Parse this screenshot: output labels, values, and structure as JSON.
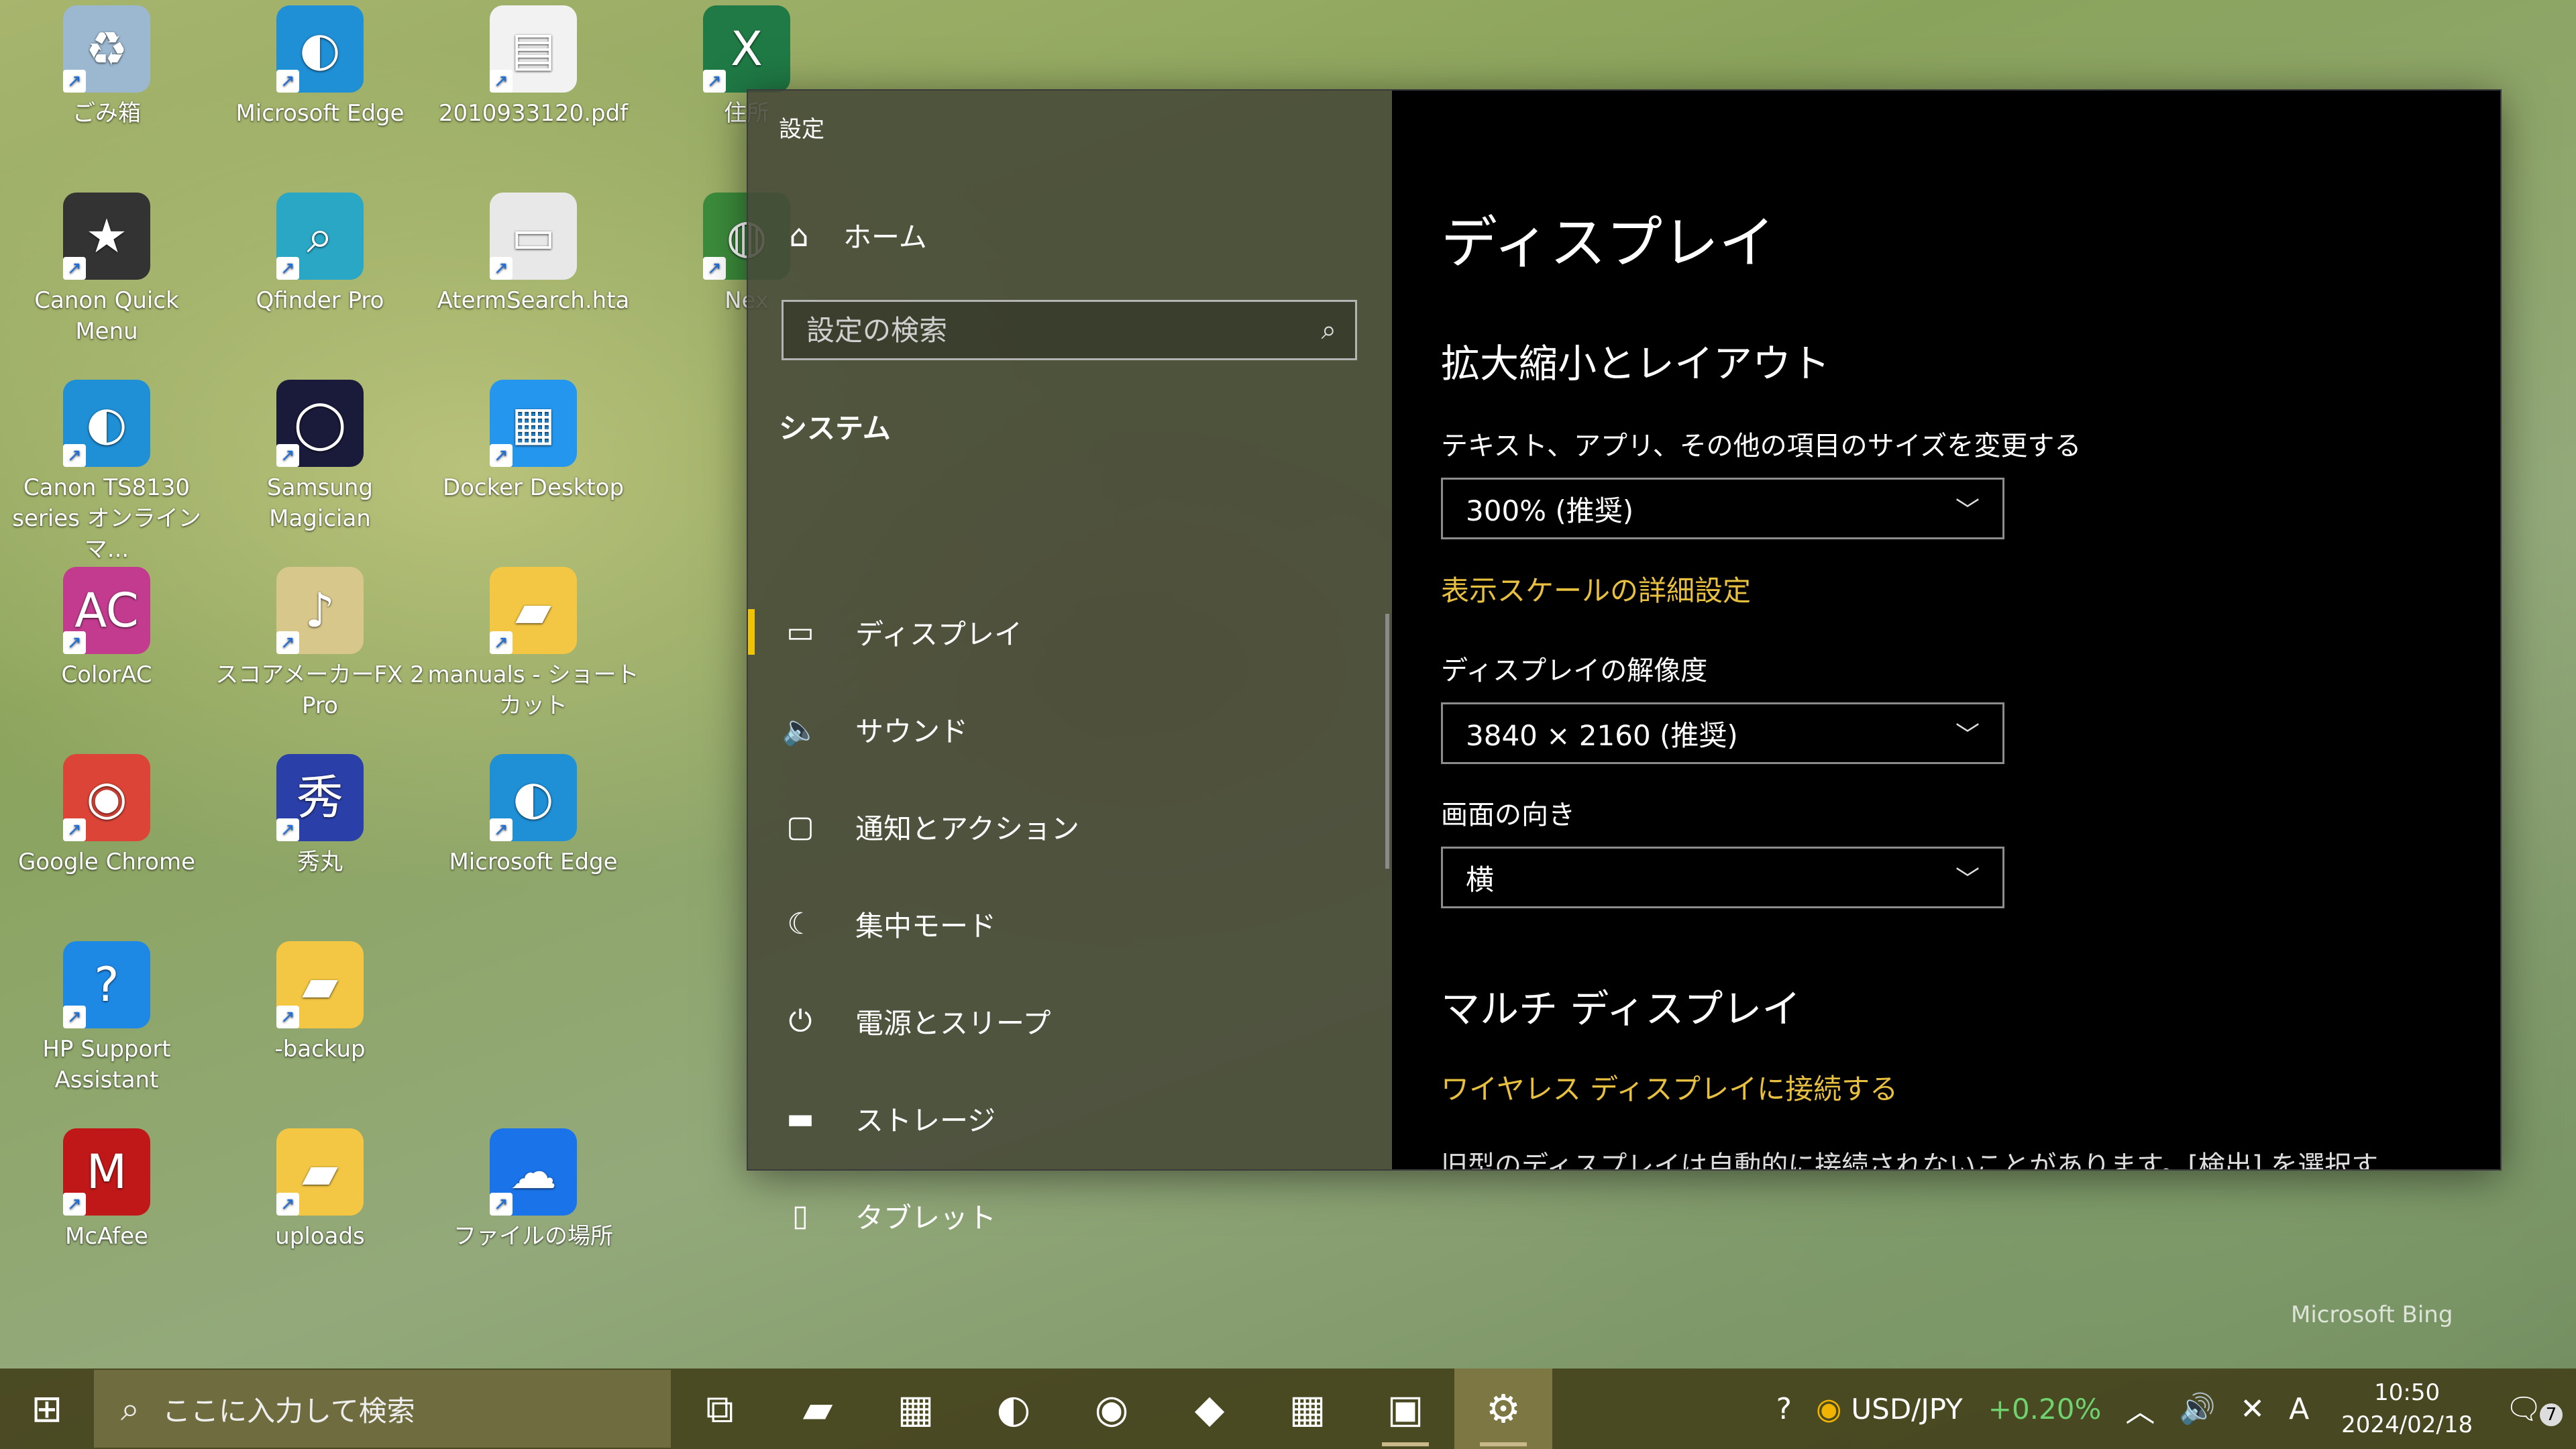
{
  "desktop": {
    "icons": [
      {
        "label": "ごみ箱",
        "icon": "recycle-bin-icon",
        "color": "#9bb8d0"
      },
      {
        "label": "Microsoft Edge",
        "icon": "edge-icon",
        "color": "#1f8fd6"
      },
      {
        "label": "2010933120.pdf",
        "icon": "pdf-file-icon",
        "color": "#f2f2f2"
      },
      {
        "label": "住所",
        "icon": "excel-icon",
        "color": "#1f7a45"
      },
      {
        "label": "Canon Quick Menu",
        "icon": "canon-quick-menu-icon",
        "color": "#333333"
      },
      {
        "label": "Qfinder Pro",
        "icon": "qfinder-icon",
        "color": "#2aa7c5"
      },
      {
        "label": "AtermSearch.hta",
        "icon": "aterm-icon",
        "color": "#e8e8e8"
      },
      {
        "label": "Nex",
        "icon": "globe-icon",
        "color": "#3c8c3c"
      },
      {
        "label": "Canon TS8130 series オンラインマ...",
        "icon": "edge-icon",
        "color": "#1f8fd6"
      },
      {
        "label": "Samsung Magician",
        "icon": "samsung-magician-icon",
        "color": "#1a1a3a"
      },
      {
        "label": "Docker Desktop",
        "icon": "docker-icon",
        "color": "#2496ed"
      },
      {
        "label": "ColorAC",
        "icon": "colorac-icon",
        "color": "#c23b8f"
      },
      {
        "label": "スコアメーカーFX 2 Pro",
        "icon": "score-maker-icon",
        "color": "#d8c78a"
      },
      {
        "label": "manuals - ショートカット",
        "icon": "folder-icon",
        "color": "#f3c744"
      },
      {
        "label": "Google Chrome",
        "icon": "chrome-icon",
        "color": "#db4437"
      },
      {
        "label": "秀丸",
        "icon": "hidemaru-icon",
        "color": "#2b3fa8"
      },
      {
        "label": "Microsoft Edge",
        "icon": "edge-icon",
        "color": "#1f8fd6"
      },
      {
        "label": "HP Support Assistant",
        "icon": "hp-support-icon",
        "color": "#1e88e5"
      },
      {
        "label": "-backup",
        "icon": "folder-icon",
        "color": "#f3c744"
      },
      {
        "label": "McAfee",
        "icon": "mcafee-icon",
        "color": "#c01818"
      },
      {
        "label": "uploads",
        "icon": "folder-icon",
        "color": "#f3c744"
      },
      {
        "label": "ファイルの場所",
        "icon": "onedrive-icon",
        "color": "#1a73e8"
      }
    ],
    "watermark": "Microsoft Bing"
  },
  "settings": {
    "title": "設定",
    "home": "ホーム",
    "search_placeholder": "設定の検索",
    "section": "システム",
    "nav": [
      {
        "label": "ディスプレイ",
        "icon": "monitor-icon",
        "active": true
      },
      {
        "label": "サウンド",
        "icon": "speaker-icon",
        "active": false
      },
      {
        "label": "通知とアクション",
        "icon": "notification-icon",
        "active": false
      },
      {
        "label": "集中モード",
        "icon": "moon-icon",
        "active": false
      },
      {
        "label": "電源とスリープ",
        "icon": "power-icon",
        "active": false
      },
      {
        "label": "ストレージ",
        "icon": "storage-icon",
        "active": false
      },
      {
        "label": "タブレット",
        "icon": "tablet-icon",
        "active": false
      }
    ],
    "main": {
      "page_title": "ディスプレイ",
      "scale_section": "拡大縮小とレイアウト",
      "scale_label": "テキスト、アプリ、その他の項目のサイズを変更する",
      "scale_value": "300% (推奨)",
      "scale_link": "表示スケールの詳細設定",
      "resolution_label": "ディスプレイの解像度",
      "resolution_value": "3840 × 2160 (推奨)",
      "orientation_label": "画面の向き",
      "orientation_value": "横",
      "multi_section": "マルチ ディスプレイ",
      "wireless_link": "ワイヤレス ディスプレイに接続する",
      "cut_text": "旧型のディスプレイは自動的に接続されないことがあります。[検出] を選択す"
    }
  },
  "taskbar": {
    "search_placeholder": "ここに入力して検索",
    "apps": [
      {
        "icon": "task-view-icon",
        "running": false,
        "active": false
      },
      {
        "icon": "file-explorer-icon",
        "running": false,
        "active": false
      },
      {
        "icon": "microsoft-store-icon",
        "running": false,
        "active": false
      },
      {
        "icon": "edge-icon",
        "running": false,
        "active": false
      },
      {
        "icon": "chrome-icon",
        "running": false,
        "active": false
      },
      {
        "icon": "copilot-icon",
        "running": false,
        "active": false
      },
      {
        "icon": "docker-icon",
        "running": false,
        "active": false
      },
      {
        "icon": "remote-desktop-icon",
        "running": true,
        "active": false
      },
      {
        "icon": "settings-gear-icon",
        "running": true,
        "active": true
      }
    ],
    "widget_label": "USD/JPY",
    "widget_change": "+0.20%",
    "time": "10:50",
    "date": "2024/02/18",
    "notification_count": "7"
  }
}
